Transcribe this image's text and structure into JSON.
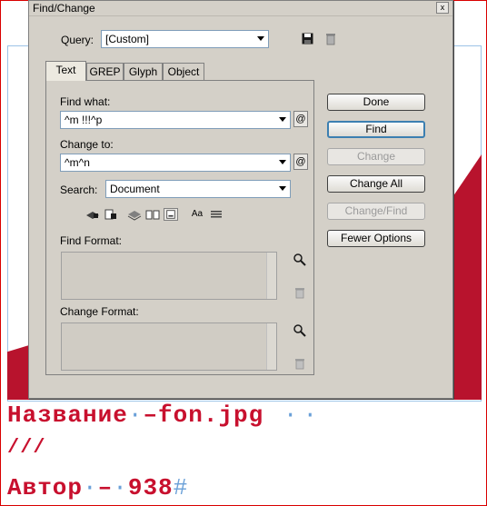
{
  "dialog": {
    "title": "Find/Change",
    "close_glyph": "x",
    "query_label": "Query:",
    "query_value": "[Custom]",
    "save_query_icon": "floppy-disk-icon",
    "delete_query_icon": "trash-icon"
  },
  "tabs": [
    {
      "label": "Text",
      "active": true
    },
    {
      "label": "GREP",
      "active": false
    },
    {
      "label": "Glyph",
      "active": false
    },
    {
      "label": "Object",
      "active": false
    }
  ],
  "find": {
    "label": "Find what:",
    "value": "^m !!!^p"
  },
  "change": {
    "label": "Change to:",
    "value": "^m^n"
  },
  "special_char_glyph": "@",
  "search": {
    "label": "Search:",
    "value": "Document"
  },
  "case_glyph": "Aa",
  "find_format": {
    "label": "Find Format:"
  },
  "change_format": {
    "label": "Change Format:"
  },
  "buttons": {
    "done": "Done",
    "find": "Find",
    "change": "Change",
    "change_all": "Change All",
    "change_find": "Change/Find",
    "fewer_options": "Fewer Options"
  },
  "document": {
    "line1": "Название",
    "line1b": "fon.jpg",
    "line2": "///",
    "line3": "Автор",
    "line3b": "938",
    "hash": "#",
    "dash": "–",
    "dot": "·"
  },
  "colors": {
    "dialog_bg": "#d4d0c8",
    "accent_red": "#b8132d",
    "text_red": "#c8102e",
    "guide_blue": "#9cc3e6"
  }
}
